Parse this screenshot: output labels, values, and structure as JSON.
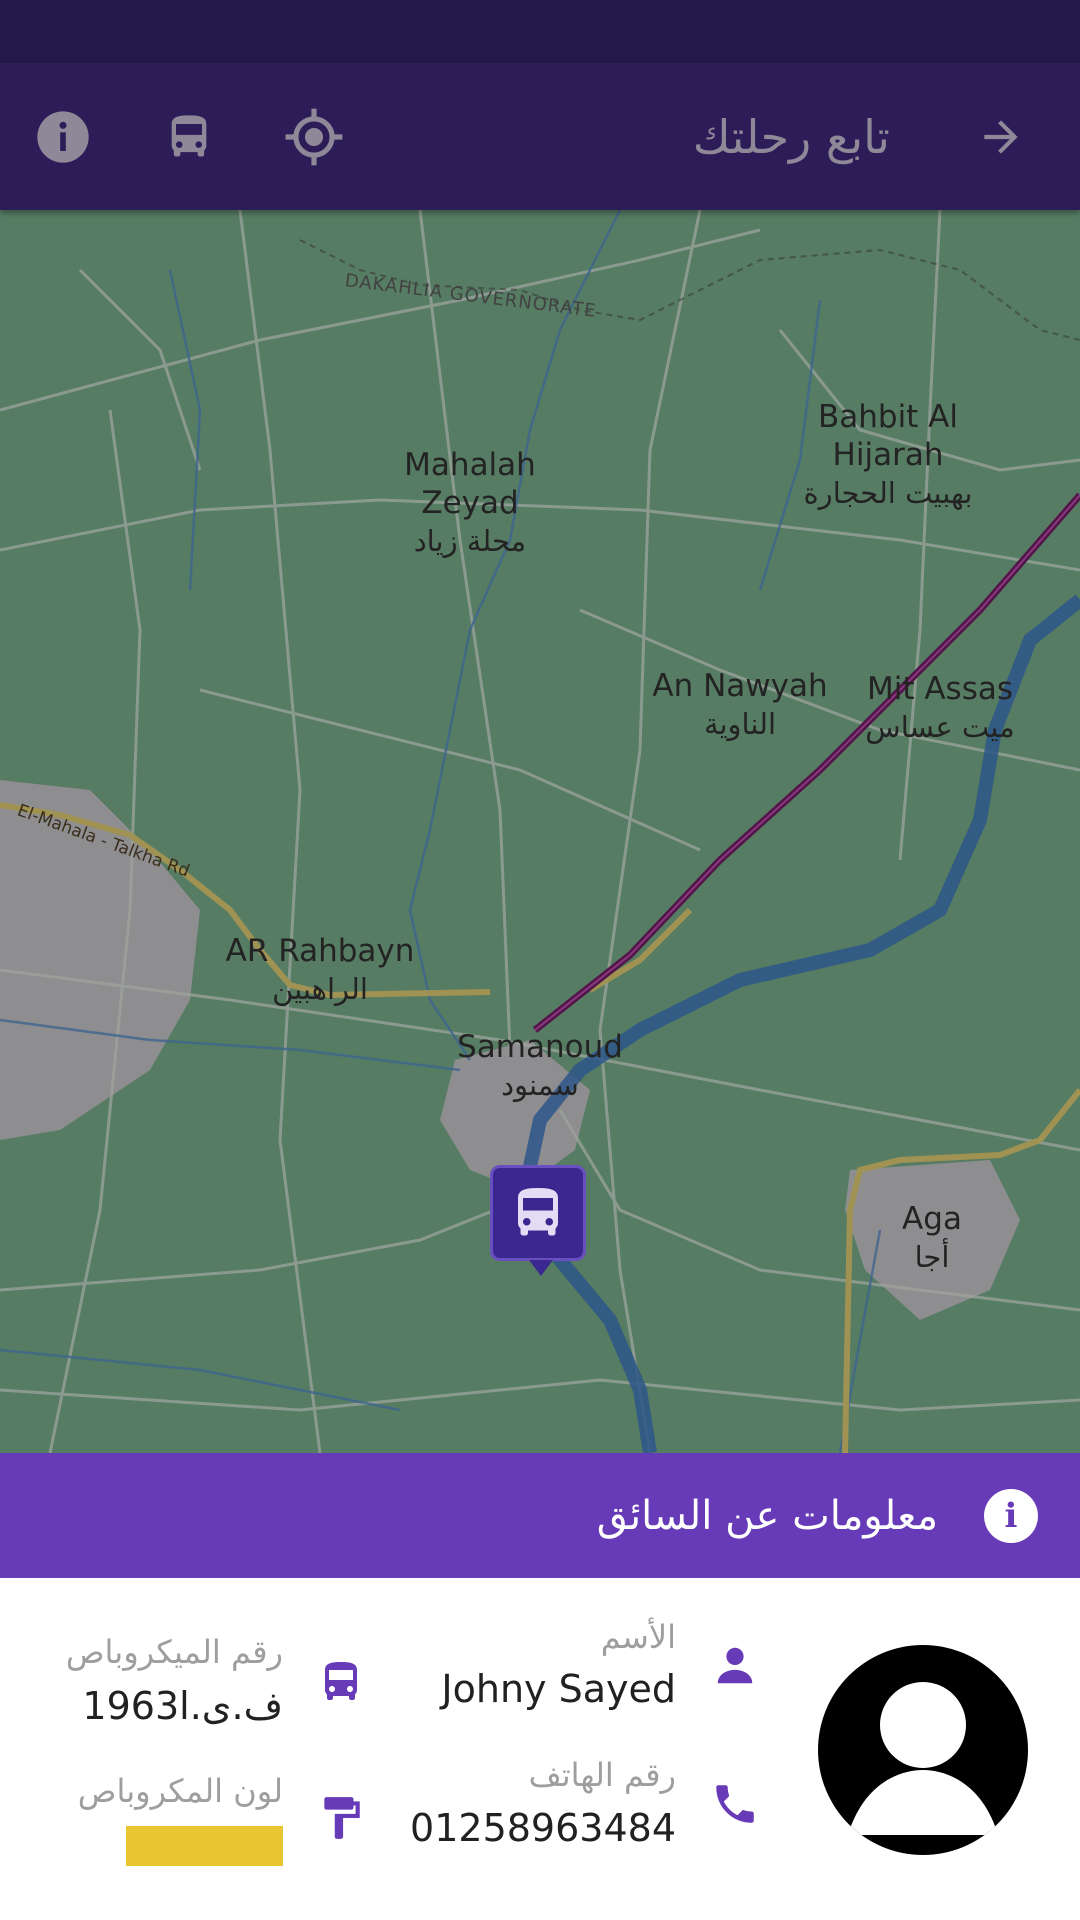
{
  "app": {
    "toolbar": {
      "title": "تابع رحلتك",
      "icons": [
        "back-arrow-icon",
        "location-target-icon",
        "bus-icon",
        "info-icon"
      ]
    }
  },
  "map": {
    "places": [
      {
        "en": "Mahalah\nZeyad",
        "ar": "محلة زياد"
      },
      {
        "en": "Bahbit Al\nHijarah",
        "ar": "بهبيت الحجارة"
      },
      {
        "en": "An Nawyah",
        "ar": "الناوية"
      },
      {
        "en": "Mit Assas",
        "ar": "ميت عساس"
      },
      {
        "en": "AR Rahbayn",
        "ar": "الراهبين"
      },
      {
        "en": "Samanoud",
        "ar": "سمنود"
      },
      {
        "en": "Aga",
        "ar": "أجا"
      }
    ],
    "road_label": "El-Mahala - Talkha Rd",
    "governorate_label": "DAKAHLIA GOVERNORATE"
  },
  "driver_info": {
    "header": "معلومات عن السائق",
    "name_label": "الأسم",
    "name_value": "Johny Sayed",
    "phone_label": "رقم الهاتف",
    "phone_value": "01258963484",
    "bus_number_label": "رقم الميكروباص",
    "bus_number_value": "1963ف.ى.ا",
    "bus_color_label": "لون المكروباص",
    "bus_color_value": "#e8c531"
  }
}
